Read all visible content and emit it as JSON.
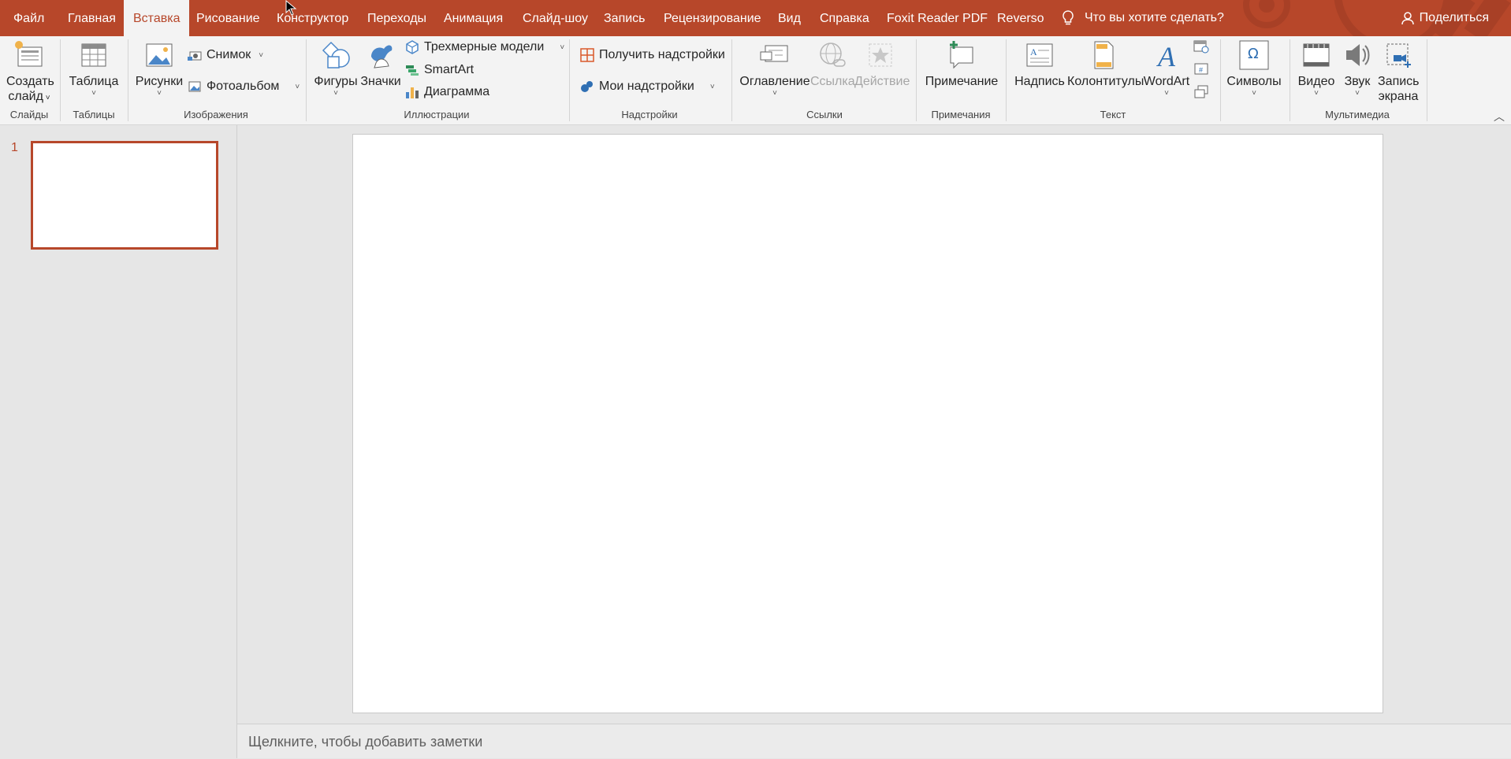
{
  "tabs": [
    {
      "label": "Файл"
    },
    {
      "label": "Главная"
    },
    {
      "label": "Вставка"
    },
    {
      "label": "Рисование"
    },
    {
      "label": "Конструктор"
    },
    {
      "label": "Переходы"
    },
    {
      "label": "Анимация"
    },
    {
      "label": "Слайд-шоу"
    },
    {
      "label": "Запись"
    },
    {
      "label": "Рецензирование"
    },
    {
      "label": "Вид"
    },
    {
      "label": "Справка"
    },
    {
      "label": "Foxit Reader PDF"
    },
    {
      "label": "Reverso"
    }
  ],
  "active_tab": "Вставка",
  "tell_me": "Что вы хотите сделать?",
  "share": "Поделиться",
  "ribbon": {
    "slides": {
      "new_slide_1": "Создать",
      "new_slide_2": "слайд",
      "group": "Слайды"
    },
    "tables": {
      "table": "Таблица",
      "group": "Таблицы"
    },
    "images": {
      "pictures": "Рисунки",
      "screenshot": "Снимок",
      "photo_album": "Фотоальбом",
      "group": "Изображения"
    },
    "illustrations": {
      "shapes": "Фигуры",
      "icons": "Значки",
      "models3d": "Трехмерные модели",
      "smartart": "SmartArt",
      "chart": "Диаграмма",
      "group": "Иллюстрации"
    },
    "addins": {
      "get_addins": "Получить надстройки",
      "my_addins": "Мои надстройки",
      "group": "Надстройки"
    },
    "links": {
      "zoom": "Оглавление",
      "link": "Ссылка",
      "action": "Действие",
      "group": "Ссылки"
    },
    "comments": {
      "comment": "Примечание",
      "group": "Примечания"
    },
    "text": {
      "textbox": "Надпись",
      "header_footer": "Колонтитулы",
      "wordart": "WordArt",
      "group": "Текст"
    },
    "symbols": {
      "symbols": "Символы",
      "group": ""
    },
    "media": {
      "video": "Видео",
      "audio": "Звук",
      "screen_rec_1": "Запись",
      "screen_rec_2": "экрана",
      "group": "Мультимедиа"
    }
  },
  "thumbnail": {
    "number": "1"
  },
  "notes_placeholder": "Щелкните, чтобы добавить заметки",
  "colors": {
    "accent": "#b7472a",
    "ribbon": "#f3f3f3",
    "workspace": "#e6e6e6"
  }
}
